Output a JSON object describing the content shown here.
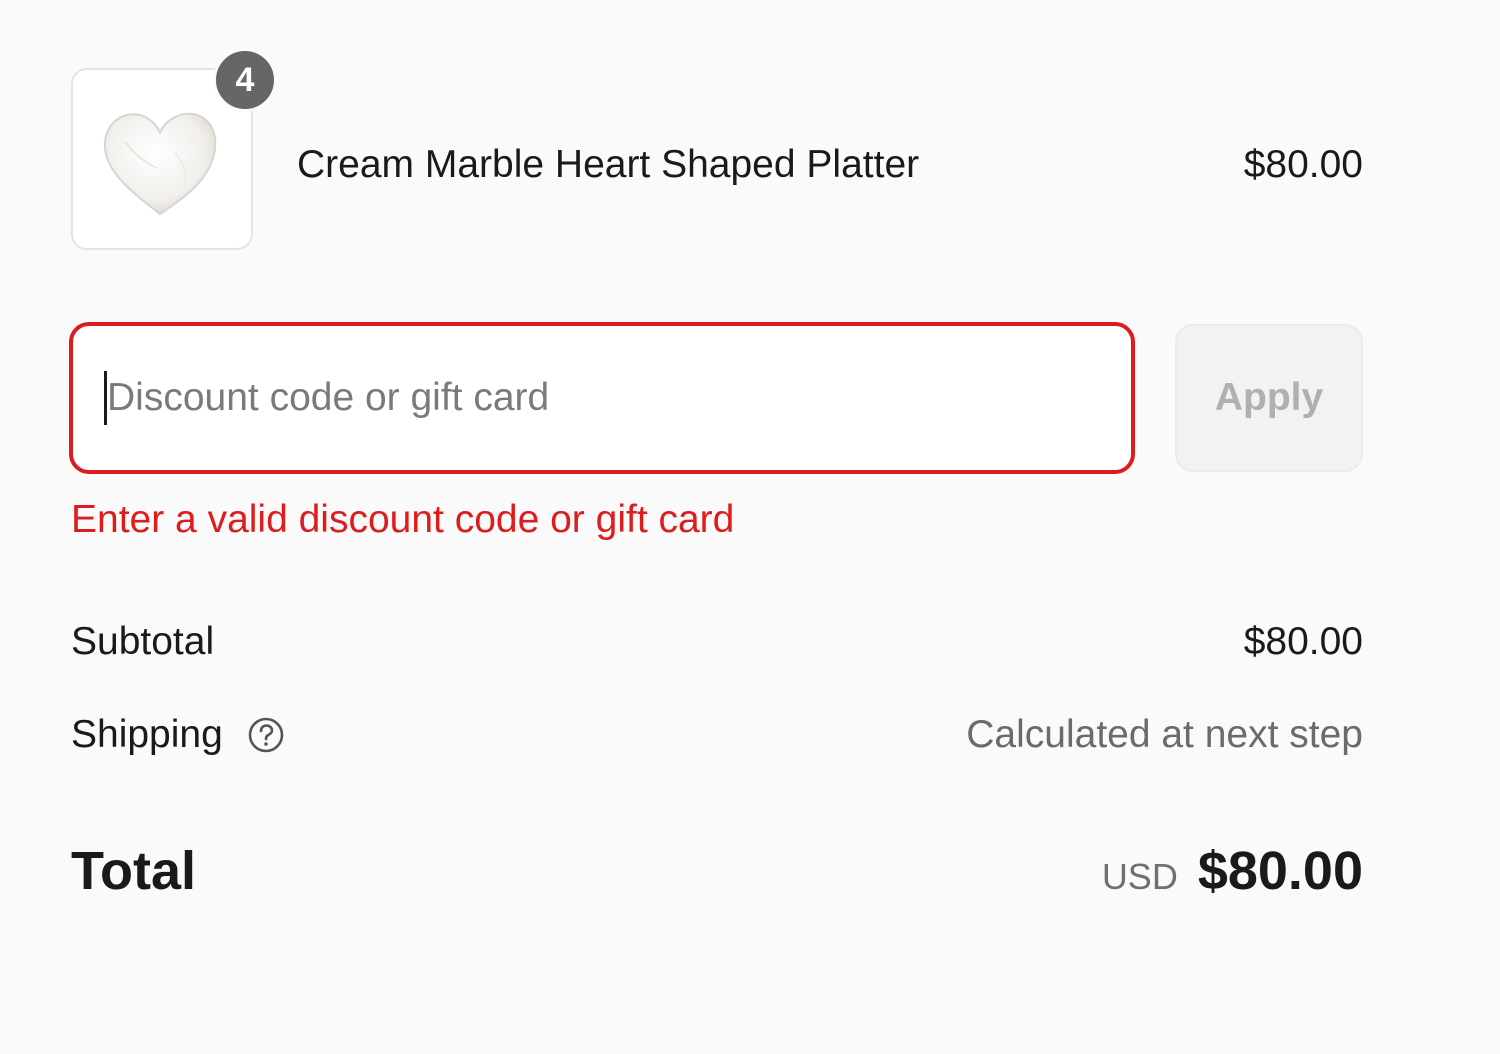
{
  "cart": {
    "items": [
      {
        "name": "Cream Marble Heart Shaped Platter",
        "price": "$80.00",
        "quantity": "4",
        "thumbnail_icon": "heart-platter-image"
      }
    ]
  },
  "discount": {
    "placeholder": "Discount code or gift card",
    "value": "",
    "apply_label": "Apply",
    "error": "Enter a valid discount code or gift card"
  },
  "summary": {
    "subtotal_label": "Subtotal",
    "subtotal_value": "$80.00",
    "shipping_label": "Shipping",
    "shipping_value": "Calculated at next step",
    "shipping_help_icon": "question-circle-icon",
    "total_label": "Total",
    "total_currency": "USD",
    "total_value": "$80.00"
  },
  "colors": {
    "error": "#dd1d1d",
    "badge": "#666666",
    "background": "#fafafa"
  }
}
